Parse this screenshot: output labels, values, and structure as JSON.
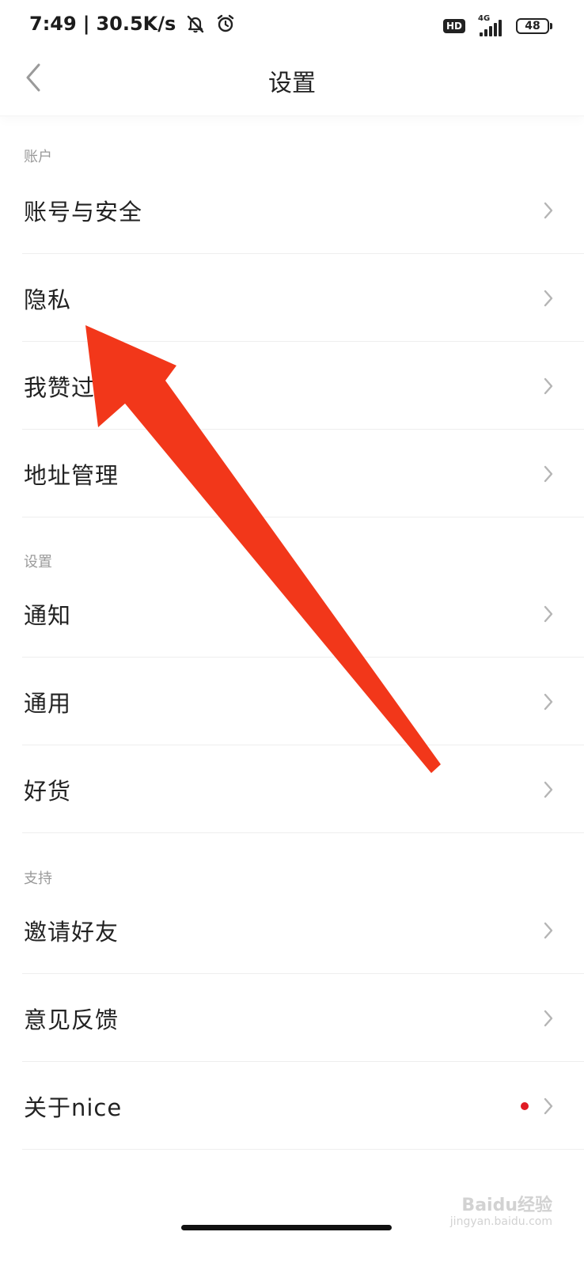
{
  "status_bar": {
    "time": "7:49",
    "separator": "|",
    "net_speed": "30.5K/s",
    "hd": "HD",
    "network": "4G",
    "battery": "48"
  },
  "header": {
    "title": "设置"
  },
  "sections": [
    {
      "label": "账户",
      "items": [
        {
          "label": "账号与安全"
        },
        {
          "label": "隐私"
        },
        {
          "label": "我赞过"
        },
        {
          "label": "地址管理"
        }
      ]
    },
    {
      "label": "设置",
      "items": [
        {
          "label": "通知"
        },
        {
          "label": "通用"
        },
        {
          "label": "好货"
        }
      ]
    },
    {
      "label": "支持",
      "items": [
        {
          "label": "邀请好友"
        },
        {
          "label": "意见反馈"
        },
        {
          "label": "关于nice",
          "has_red_dot": true
        }
      ]
    }
  ],
  "colors": {
    "annotation_arrow": "#f2371a",
    "red_dot": "#e01b24"
  },
  "watermark": {
    "main": "Baidu经验",
    "sub": "jingyan.baidu.com"
  }
}
